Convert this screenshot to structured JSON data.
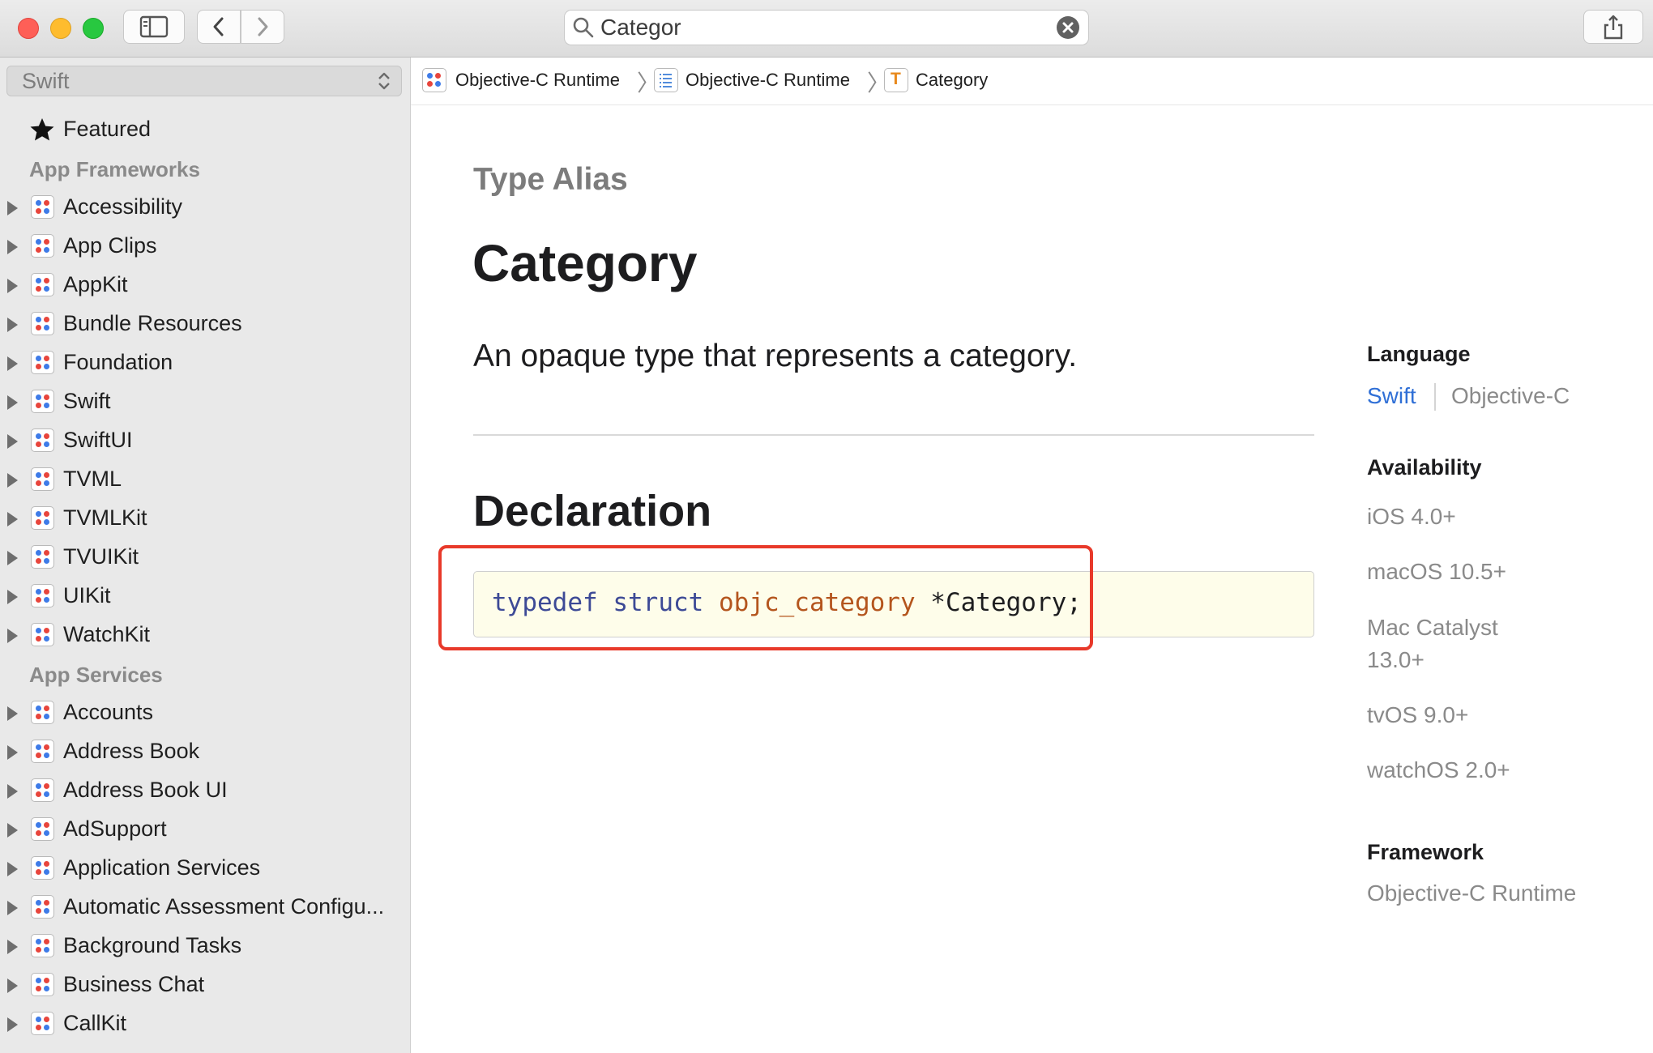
{
  "window": {
    "search": {
      "value": "Categor",
      "placeholder": ""
    }
  },
  "sidebar": {
    "language_select": "Swift",
    "featured": "Featured",
    "sections": [
      {
        "title": "App Frameworks",
        "items": [
          "Accessibility",
          "App Clips",
          "AppKit",
          "Bundle Resources",
          "Foundation",
          "Swift",
          "SwiftUI",
          "TVML",
          "TVMLKit",
          "TVUIKit",
          "UIKit",
          "WatchKit"
        ]
      },
      {
        "title": "App Services",
        "items": [
          "Accounts",
          "Address Book",
          "Address Book UI",
          "AdSupport",
          "Application Services",
          "Automatic Assessment Configu...",
          "Background Tasks",
          "Business Chat",
          "CallKit"
        ]
      }
    ]
  },
  "breadcrumb": [
    {
      "label": "Objective-C Runtime",
      "icon": "framework-icon"
    },
    {
      "label": "Objective-C Runtime",
      "icon": "list-icon"
    },
    {
      "label": "Category",
      "icon": "type-alias-icon",
      "icon_letter": "T"
    }
  ],
  "main": {
    "eyebrow": "Type Alias",
    "title": "Category",
    "abstract": "An opaque type that represents a category.",
    "declaration_heading": "Declaration",
    "code": {
      "kw1": "typedef",
      "kw2": "struct",
      "type": "objc_category",
      "rest": "*Category;"
    }
  },
  "metadata": {
    "language_heading": "Language",
    "language_swift": "Swift",
    "language_objc": "Objective-C",
    "availability_heading": "Availability",
    "availability": [
      "iOS 4.0+",
      "macOS 10.5+",
      "Mac Catalyst",
      "13.0+",
      "tvOS 9.0+",
      "watchOS 2.0+"
    ],
    "framework_heading": "Framework",
    "framework": "Objective-C Runtime"
  },
  "colors": {
    "accent_link": "#2f6fd6",
    "highlight": "#e8392a",
    "code_keyword": "#3d4a96",
    "code_type": "#b4551d",
    "code_bg": "#fefdea"
  }
}
